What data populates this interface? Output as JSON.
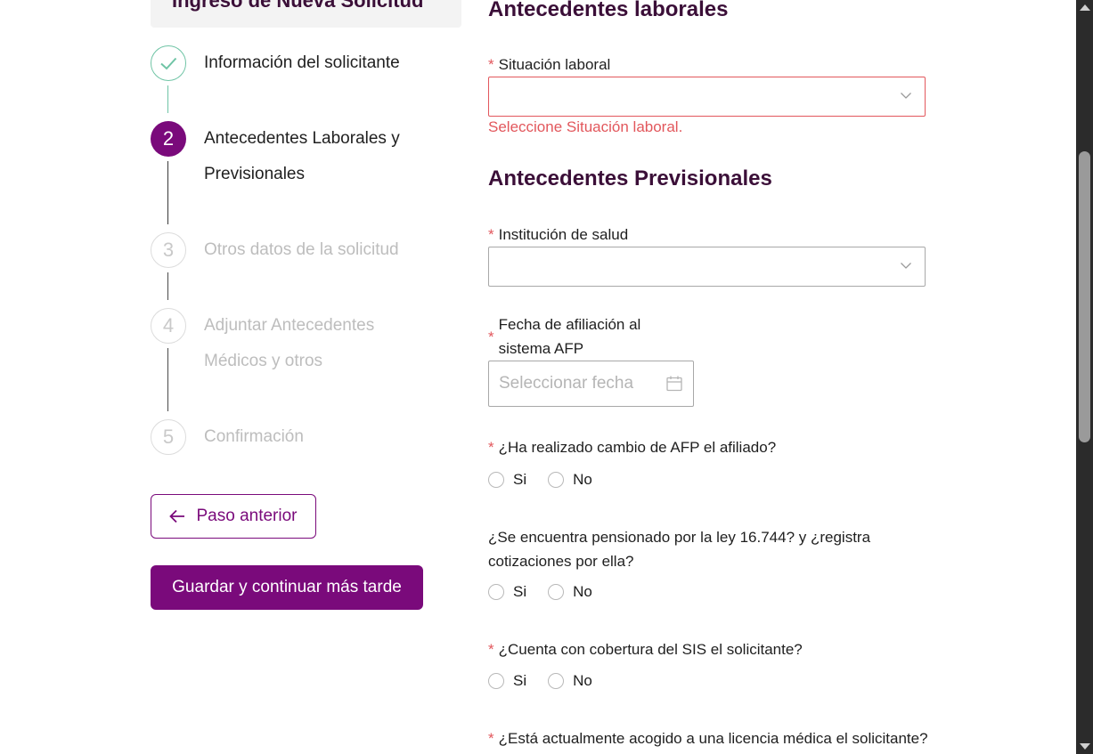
{
  "header": {
    "title": "Ingreso de Nueva Solicitud"
  },
  "steps": [
    {
      "num": "",
      "label": "Información del solicitante",
      "status": "done"
    },
    {
      "num": "2",
      "label": "Antecedentes Laborales y Previsionales",
      "status": "active"
    },
    {
      "num": "3",
      "label": "Otros datos de la solicitud",
      "status": "pending"
    },
    {
      "num": "4",
      "label": "Adjuntar Antecedentes Médicos y otros",
      "status": "pending"
    },
    {
      "num": "5",
      "label": "Confirmación",
      "status": "pending"
    }
  ],
  "nav": {
    "back_label": "Paso anterior",
    "save_label": "Guardar y continuar más tarde"
  },
  "form": {
    "laborales_title": "Antecedentes laborales",
    "situacion_label": "Situación laboral",
    "situacion_value": "",
    "situacion_error": "Seleccione Situación laboral.",
    "previsionales_title": "Antecedentes Previsionales",
    "salud_label": "Institución de salud",
    "salud_value": "",
    "fecha_label_1": "Fecha de afiliación al",
    "fecha_label_2": "sistema AFP",
    "fecha_placeholder": "Seleccionar fecha",
    "q_cambio_afp": "¿Ha realizado cambio de AFP el afiliado?",
    "q_pensionado_1": "¿Se encuentra pensionado por la ley 16.744? y ¿registra",
    "q_pensionado_2": "cotizaciones por ella?",
    "q_sis": "¿Cuenta con cobertura del SIS el solicitante?",
    "q_licencia": "¿Está actualmente acogido a una licencia médica el solicitante?",
    "yes": "Si",
    "no": "No"
  },
  "colors": {
    "primary": "#7a0a7b",
    "title": "#3b0f38",
    "success": "#6fc4a5",
    "error": "#e2575c"
  },
  "icons": [
    "check-icon",
    "arrow-left-icon",
    "chevron-down-icon",
    "calendar-icon"
  ]
}
